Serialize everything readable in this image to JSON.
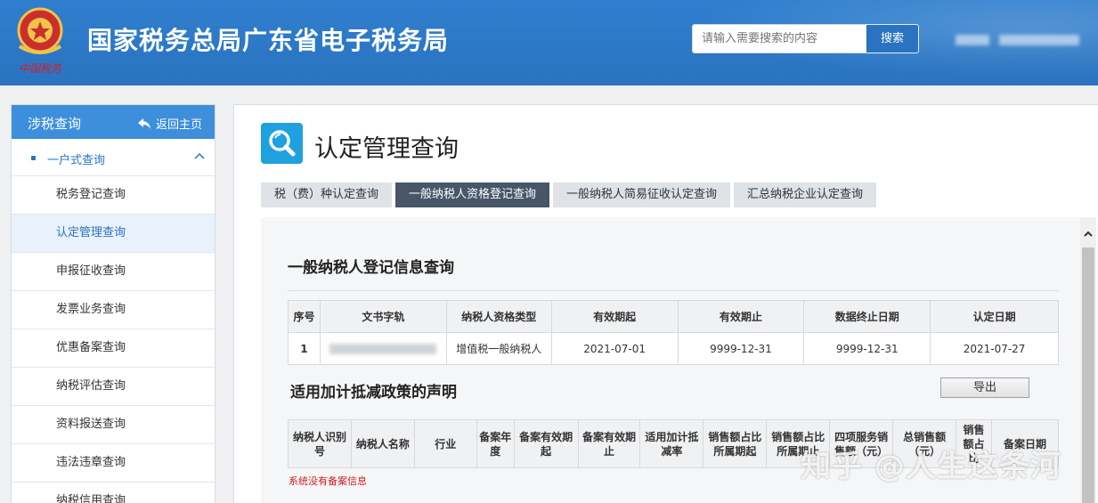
{
  "header": {
    "site_title": "国家税务总局广东省电子税务局",
    "search_placeholder": "请输入需要搜索的内容",
    "search_button": "搜索",
    "logo_text": "中国税务"
  },
  "sidebar": {
    "title": "涉税查询",
    "home_link": "返回主页",
    "group_label": "一户式查询",
    "items": [
      {
        "label": "税务登记查询"
      },
      {
        "label": "认定管理查询"
      },
      {
        "label": "申报征收查询"
      },
      {
        "label": "发票业务查询"
      },
      {
        "label": "优惠备案查询"
      },
      {
        "label": "纳税评估查询"
      },
      {
        "label": "资料报送查询"
      },
      {
        "label": "违法违章查询"
      },
      {
        "label": "纳税信用查询"
      }
    ],
    "active_index": 1
  },
  "main": {
    "page_title": "认定管理查询",
    "tabs": [
      {
        "label": "税（费）种认定查询"
      },
      {
        "label": "一般纳税人资格登记查询"
      },
      {
        "label": "一般纳税人简易征收认定查询"
      },
      {
        "label": "汇总纳税企业认定查询"
      }
    ],
    "active_tab": 1,
    "section1": {
      "title": "一般纳税人登记信息查询",
      "columns": [
        "序号",
        "文书字轨",
        "纳税人资格类型",
        "有效期起",
        "有效期止",
        "数据终止日期",
        "认定日期"
      ],
      "rows": [
        {
          "seq": "1",
          "doc": "",
          "type": "增值税一般纳税人",
          "start": "2021-07-01",
          "end": "9999-12-31",
          "data_end": "9999-12-31",
          "date": "2021-07-27"
        }
      ]
    },
    "section2": {
      "title": "适用加计抵减政策的声明",
      "export_button": "导出",
      "columns": [
        "纳税人识别号",
        "纳税人名称",
        "行业",
        "备案年度",
        "备案有效期起",
        "备案有效期止",
        "适用加计抵减率",
        "销售额占比所属期起",
        "销售额占比所属期止",
        "四项服务销售额（元）",
        "总销售额（元）",
        "销售额占比",
        "备案日期"
      ],
      "empty_message": "系统没有备案信息"
    },
    "watermark": "知乎 @人生这条河"
  },
  "colors": {
    "header_blue": "#2a73c0",
    "sidebar_head": "#3d8fdb",
    "active_tab": "#475669",
    "icon_blue": "#1fa0df",
    "error_red": "#c81e1e"
  }
}
